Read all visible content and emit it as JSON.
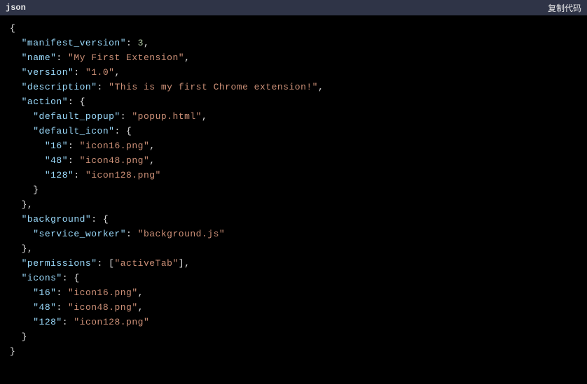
{
  "header": {
    "language": "json",
    "copyLabel": "复制代码"
  },
  "code": {
    "lines": [
      {
        "indent": 0,
        "tokens": [
          {
            "t": "punc",
            "v": "{"
          }
        ]
      },
      {
        "indent": 1,
        "tokens": [
          {
            "t": "key",
            "v": "\"manifest_version\""
          },
          {
            "t": "colon",
            "v": ": "
          },
          {
            "t": "number",
            "v": "3"
          },
          {
            "t": "punc",
            "v": ","
          }
        ]
      },
      {
        "indent": 1,
        "tokens": [
          {
            "t": "key",
            "v": "\"name\""
          },
          {
            "t": "colon",
            "v": ": "
          },
          {
            "t": "string",
            "v": "\"My First Extension\""
          },
          {
            "t": "punc",
            "v": ","
          }
        ]
      },
      {
        "indent": 1,
        "tokens": [
          {
            "t": "key",
            "v": "\"version\""
          },
          {
            "t": "colon",
            "v": ": "
          },
          {
            "t": "string",
            "v": "\"1.0\""
          },
          {
            "t": "punc",
            "v": ","
          }
        ]
      },
      {
        "indent": 1,
        "tokens": [
          {
            "t": "key",
            "v": "\"description\""
          },
          {
            "t": "colon",
            "v": ": "
          },
          {
            "t": "string",
            "v": "\"This is my first Chrome extension!\""
          },
          {
            "t": "punc",
            "v": ","
          }
        ]
      },
      {
        "indent": 1,
        "tokens": [
          {
            "t": "key",
            "v": "\"action\""
          },
          {
            "t": "colon",
            "v": ": "
          },
          {
            "t": "punc",
            "v": "{"
          }
        ]
      },
      {
        "indent": 2,
        "tokens": [
          {
            "t": "key",
            "v": "\"default_popup\""
          },
          {
            "t": "colon",
            "v": ": "
          },
          {
            "t": "string",
            "v": "\"popup.html\""
          },
          {
            "t": "punc",
            "v": ","
          }
        ]
      },
      {
        "indent": 2,
        "tokens": [
          {
            "t": "key",
            "v": "\"default_icon\""
          },
          {
            "t": "colon",
            "v": ": "
          },
          {
            "t": "punc",
            "v": "{"
          }
        ]
      },
      {
        "indent": 3,
        "tokens": [
          {
            "t": "key",
            "v": "\"16\""
          },
          {
            "t": "colon",
            "v": ": "
          },
          {
            "t": "string",
            "v": "\"icon16.png\""
          },
          {
            "t": "punc",
            "v": ","
          }
        ]
      },
      {
        "indent": 3,
        "tokens": [
          {
            "t": "key",
            "v": "\"48\""
          },
          {
            "t": "colon",
            "v": ": "
          },
          {
            "t": "string",
            "v": "\"icon48.png\""
          },
          {
            "t": "punc",
            "v": ","
          }
        ]
      },
      {
        "indent": 3,
        "tokens": [
          {
            "t": "key",
            "v": "\"128\""
          },
          {
            "t": "colon",
            "v": ": "
          },
          {
            "t": "string",
            "v": "\"icon128.png\""
          }
        ]
      },
      {
        "indent": 2,
        "tokens": [
          {
            "t": "punc",
            "v": "}"
          }
        ]
      },
      {
        "indent": 1,
        "tokens": [
          {
            "t": "punc",
            "v": "},"
          }
        ]
      },
      {
        "indent": 1,
        "tokens": [
          {
            "t": "key",
            "v": "\"background\""
          },
          {
            "t": "colon",
            "v": ": "
          },
          {
            "t": "punc",
            "v": "{"
          }
        ]
      },
      {
        "indent": 2,
        "tokens": [
          {
            "t": "key",
            "v": "\"service_worker\""
          },
          {
            "t": "colon",
            "v": ": "
          },
          {
            "t": "string",
            "v": "\"background.js\""
          }
        ]
      },
      {
        "indent": 1,
        "tokens": [
          {
            "t": "punc",
            "v": "},"
          }
        ]
      },
      {
        "indent": 1,
        "tokens": [
          {
            "t": "key",
            "v": "\"permissions\""
          },
          {
            "t": "colon",
            "v": ": "
          },
          {
            "t": "punc",
            "v": "["
          },
          {
            "t": "string",
            "v": "\"activeTab\""
          },
          {
            "t": "punc",
            "v": "],"
          }
        ]
      },
      {
        "indent": 1,
        "tokens": [
          {
            "t": "key",
            "v": "\"icons\""
          },
          {
            "t": "colon",
            "v": ": "
          },
          {
            "t": "punc",
            "v": "{"
          }
        ]
      },
      {
        "indent": 2,
        "tokens": [
          {
            "t": "key",
            "v": "\"16\""
          },
          {
            "t": "colon",
            "v": ": "
          },
          {
            "t": "string",
            "v": "\"icon16.png\""
          },
          {
            "t": "punc",
            "v": ","
          }
        ]
      },
      {
        "indent": 2,
        "tokens": [
          {
            "t": "key",
            "v": "\"48\""
          },
          {
            "t": "colon",
            "v": ": "
          },
          {
            "t": "string",
            "v": "\"icon48.png\""
          },
          {
            "t": "punc",
            "v": ","
          }
        ]
      },
      {
        "indent": 2,
        "tokens": [
          {
            "t": "key",
            "v": "\"128\""
          },
          {
            "t": "colon",
            "v": ": "
          },
          {
            "t": "string",
            "v": "\"icon128.png\""
          }
        ]
      },
      {
        "indent": 1,
        "tokens": [
          {
            "t": "punc",
            "v": "}"
          }
        ]
      },
      {
        "indent": 0,
        "tokens": [
          {
            "t": "punc",
            "v": "}"
          }
        ]
      }
    ]
  }
}
